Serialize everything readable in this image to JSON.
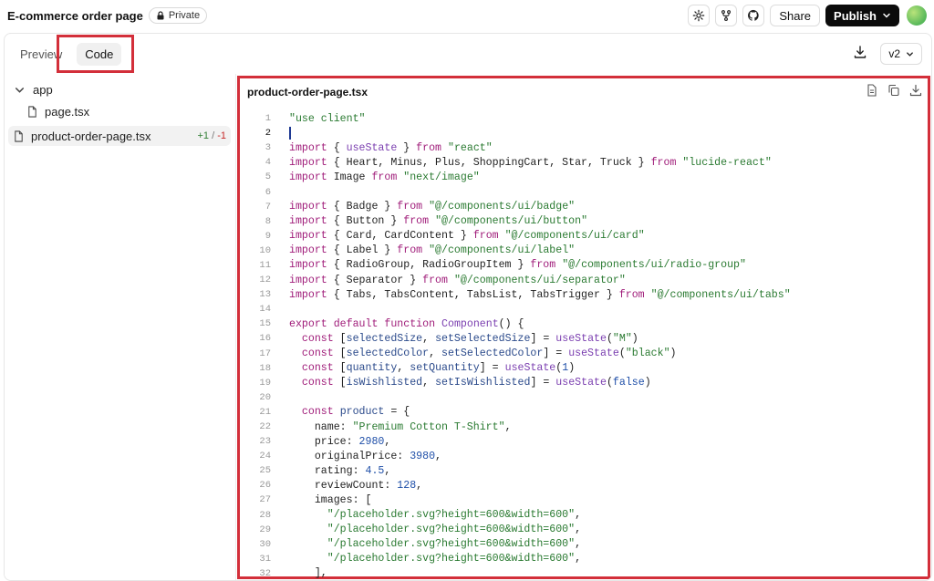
{
  "header": {
    "title": "E-commerce order page",
    "visibility": "Private",
    "share_label": "Share",
    "publish_label": "Publish",
    "icons": [
      "settings-icon",
      "fork-icon",
      "github-icon",
      "lock-icon",
      "chevron-down-icon"
    ]
  },
  "tabs": {
    "preview_label": "Preview",
    "code_label": "Code",
    "active": "Code"
  },
  "version": {
    "selected": "v2"
  },
  "file_tree": {
    "folder": "app",
    "child_file": "page.tsx",
    "selected_file": "product-order-page.tsx",
    "diff_added": "+1",
    "diff_separator": "/",
    "diff_removed": "-1"
  },
  "editor": {
    "filename": "product-order-page.tsx",
    "current_line": 2,
    "line_numbers": [
      "1",
      "2",
      "3",
      "4",
      "5",
      "6",
      "7",
      "8",
      "9",
      "10",
      "11",
      "12",
      "13",
      "14",
      "15",
      "16",
      "17",
      "18",
      "19",
      "20",
      "21",
      "22",
      "23",
      "24",
      "25",
      "26",
      "27",
      "28",
      "29",
      "30",
      "31",
      "32"
    ],
    "code_lines": [
      "\"use client\"",
      "",
      "import { useState } from \"react\"",
      "import { Heart, Minus, Plus, ShoppingCart, Star, Truck } from \"lucide-react\"",
      "import Image from \"next/image\"",
      "",
      "import { Badge } from \"@/components/ui/badge\"",
      "import { Button } from \"@/components/ui/button\"",
      "import { Card, CardContent } from \"@/components/ui/card\"",
      "import { Label } from \"@/components/ui/label\"",
      "import { RadioGroup, RadioGroupItem } from \"@/components/ui/radio-group\"",
      "import { Separator } from \"@/components/ui/separator\"",
      "import { Tabs, TabsContent, TabsList, TabsTrigger } from \"@/components/ui/tabs\"",
      "",
      "export default function Component() {",
      "  const [selectedSize, setSelectedSize] = useState(\"M\")",
      "  const [selectedColor, setSelectedColor] = useState(\"black\")",
      "  const [quantity, setQuantity] = useState(1)",
      "  const [isWishlisted, setIsWishlisted] = useState(false)",
      "",
      "  const product = {",
      "    name: \"Premium Cotton T-Shirt\",",
      "    price: 2980,",
      "    originalPrice: 3980,",
      "    rating: 4.5,",
      "    reviewCount: 128,",
      "    images: [",
      "      \"/placeholder.svg?height=600&width=600\",",
      "      \"/placeholder.svg?height=600&width=600\",",
      "      \"/placeholder.svg?height=600&width=600\",",
      "      \"/placeholder.svg?height=600&width=600\",",
      "    ],"
    ]
  },
  "colors": {
    "highlight": "#d32f3a",
    "keyword": "#a01d7a",
    "string": "#2a7a31",
    "function": "#7b3fb0",
    "number": "#1f4fa8",
    "publish_bg": "#0b0b0b"
  }
}
